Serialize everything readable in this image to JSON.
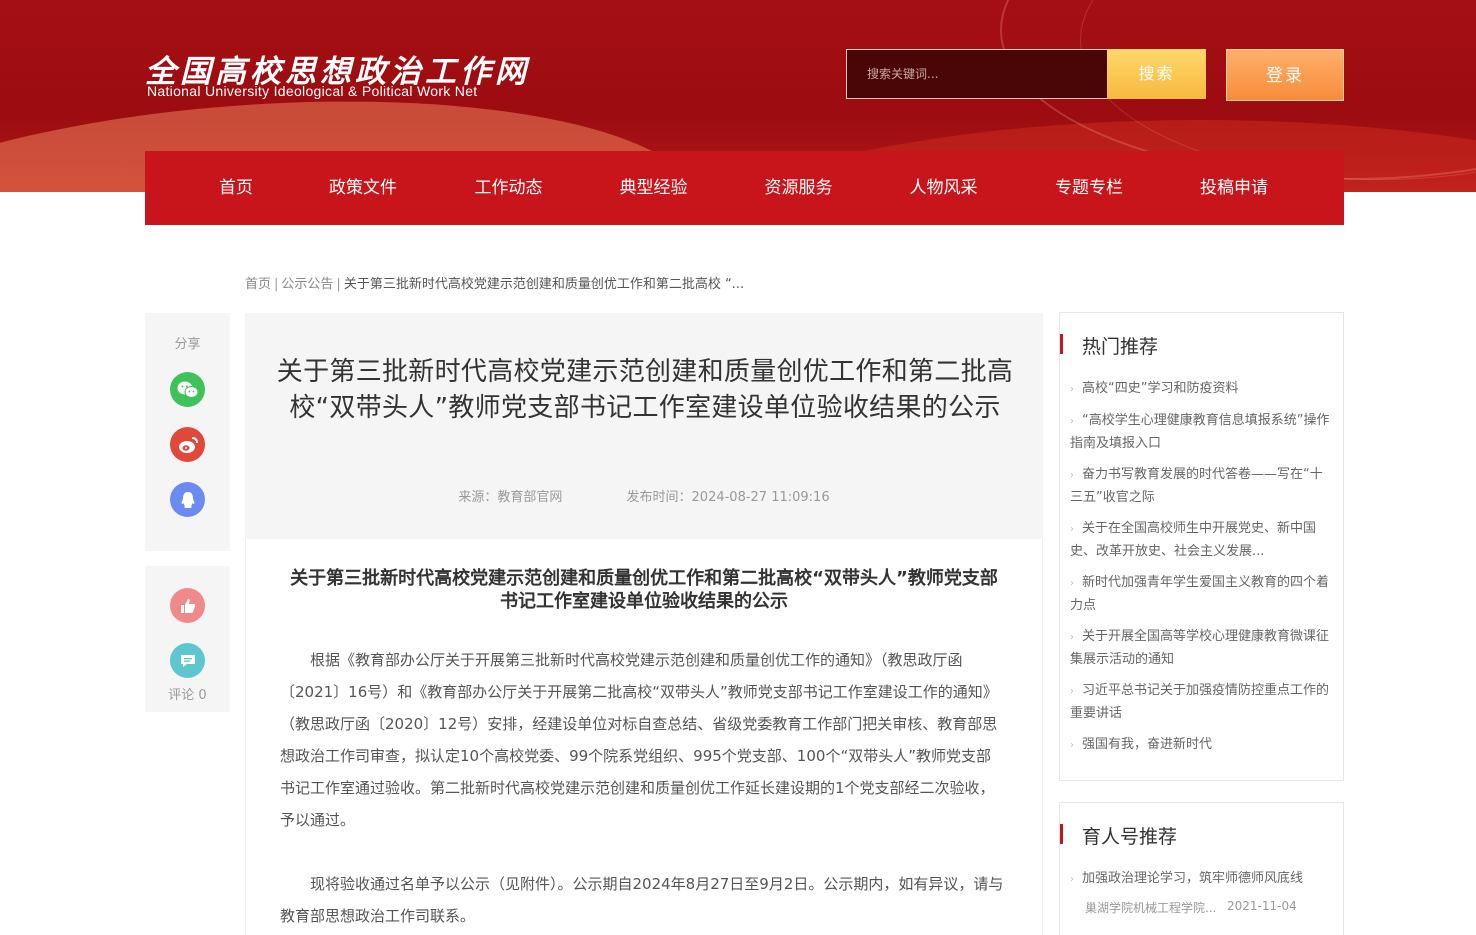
{
  "header": {
    "logo_cn": "全国高校思想政治工作网",
    "logo_en": "National University Ideological & Political Work Net",
    "search_placeholder": "搜索关键词...",
    "search_button": "搜索",
    "login_button": "登录"
  },
  "nav": [
    "首页",
    "政策文件",
    "工作动态",
    "典型经验",
    "资源服务",
    "人物风采",
    "专题专栏",
    "投稿申请"
  ],
  "breadcrumb": {
    "home": "首页",
    "section": "公示公告",
    "current": "关于第三批新时代高校党建示范创建和质量创优工作和第二批高校 “..."
  },
  "share": {
    "label": "分享",
    "icons": [
      "wechat-icon",
      "weibo-icon",
      "qq-icon"
    ],
    "comment_label": "评论 0"
  },
  "article": {
    "title": "关于第三批新时代高校党建示范创建和质量创优工作和第二批高校“双带头人”教师党支部书记工作室建设单位验收结果的公示",
    "source": "来源：教育部官网",
    "published": "发布时间：2024-08-27 11:09:16",
    "doc_title": "关于第三批新时代高校党建示范创建和质量创优工作和第二批高校“双带头人”教师党支部书记工作室建设单位验收结果的公示",
    "paragraphs": [
      "根据《教育部办公厅关于开展第三批新时代高校党建示范创建和质量创优工作的通知》（教思政厅函〔2021〕16号）和《教育部办公厅关于开展第二批高校“双带头人”教师党支部书记工作室建设工作的通知》（教思政厅函〔2020〕12号）安排，经建设单位对标自查总结、省级党委教育工作部门把关审核、教育部思想政治工作司审查，拟认定10个高校党委、99个院系党组织、995个党支部、100个“双带头人”教师党支部书记工作室通过验收。第二批新时代高校党建示范创建和质量创优工作延长建设期的1个党支部经二次验收，予以通过。",
      "现将验收通过名单予以公示（见附件）。公示期自2024年8月27日至9月2日。公示期内，如有异议，请与教育部思想政治工作司联系。"
    ]
  },
  "sidebar": {
    "hot_title": "热门推荐",
    "hot_items": [
      "高校“四史”学习和防疫资料",
      "“高校学生心理健康教育信息填报系统”操作指南及填报入口",
      "奋力书写教育发展的时代答卷——写在“十三五”收官之际",
      "关于在全国高校师生中开展党史、新中国史、改革开放史、社会主义发展...",
      "新时代加强青年学生爱国主义教育的四个着力点",
      "关于开展全国高等学校心理健康教育微课征集展示活动的通知",
      "习近平总书记关于加强疫情防控重点工作的重要讲话",
      "强国有我，奋进新时代"
    ],
    "yuren_title": "育人号推荐",
    "yuren_items": [
      {
        "title": "加强政治理论学习，筑牢师德师风底线",
        "source": "巢湖学院机械工程学院...",
        "date": "2021-11-04"
      }
    ]
  }
}
